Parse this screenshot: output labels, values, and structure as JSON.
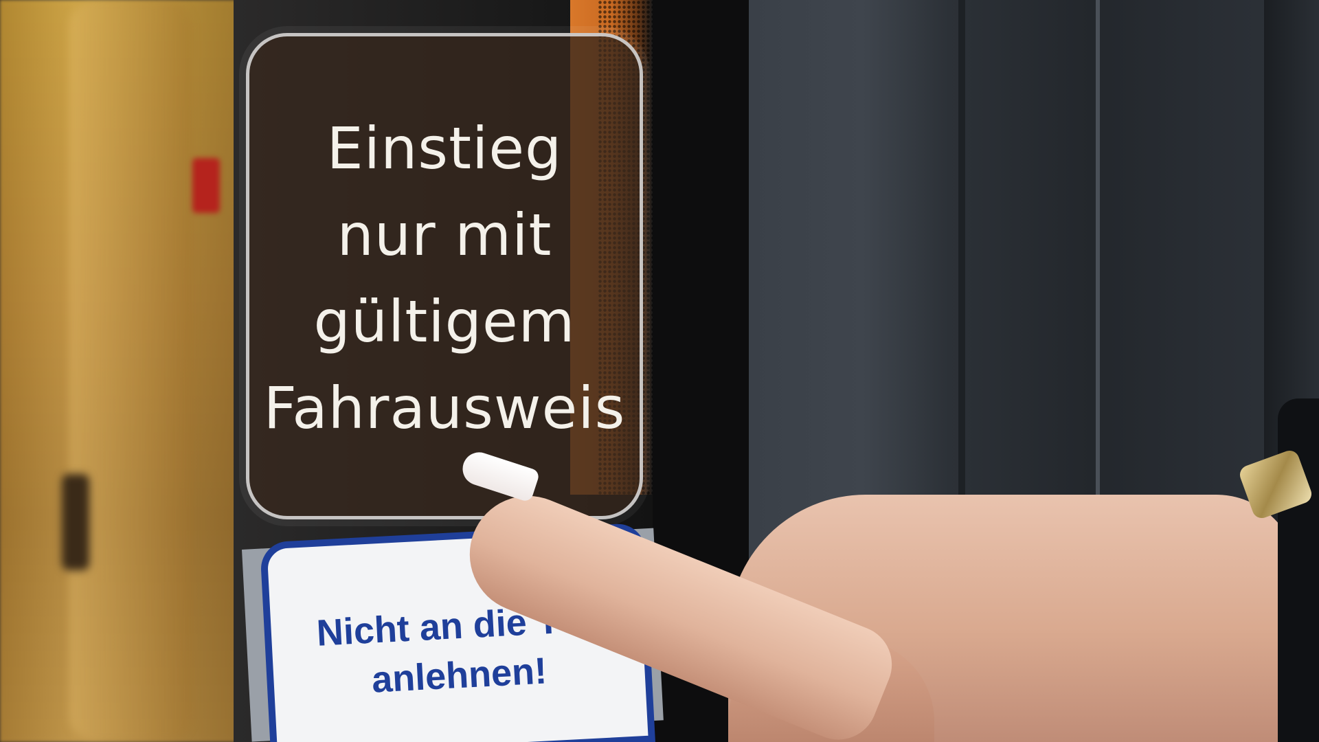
{
  "sticker": {
    "lines": [
      "Einstieg",
      "nur mit",
      "gültigem",
      "Fahrausweis"
    ],
    "text_color": "#f4f1ea",
    "background_color": "#372820"
  },
  "notice": {
    "lines": [
      "Nicht an die Tür",
      "anlehnen!"
    ],
    "text_color": "#1f3f9a",
    "border_color": "#1f3f9a"
  },
  "colors": {
    "train_interior": "#c49a3a",
    "orange_band": "#d9782a",
    "metal_wall": "#3a4048",
    "skin": "#e0b39b"
  }
}
